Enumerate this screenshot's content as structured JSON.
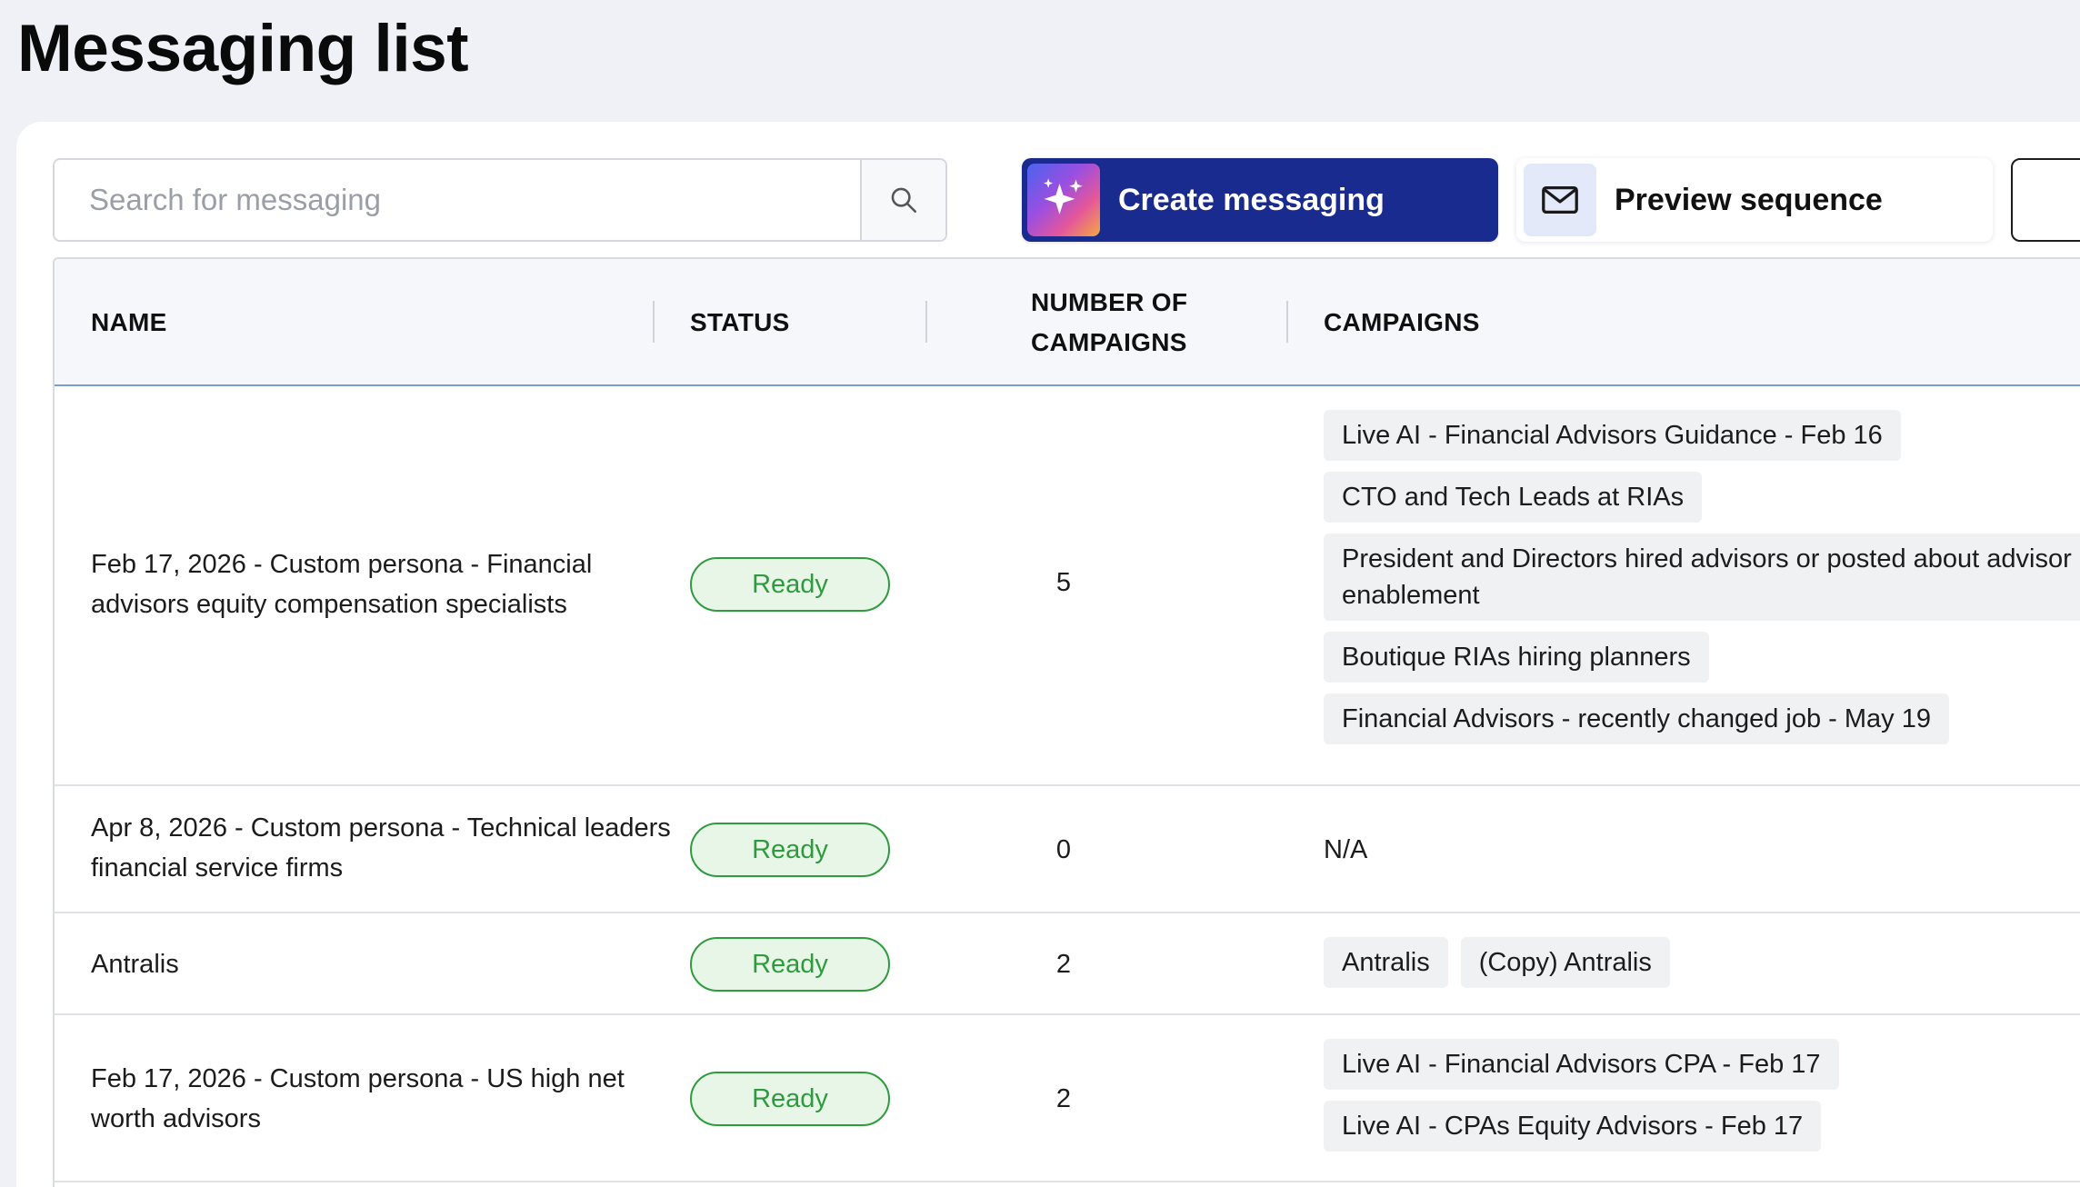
{
  "page": {
    "title": "Messaging list"
  },
  "toolbar": {
    "search_placeholder": "Search for messaging",
    "create_label": "Create messaging",
    "preview_label": "Preview sequence"
  },
  "table": {
    "headers": {
      "name": "NAME",
      "status": "STATUS",
      "count_line1": "NUMBER OF",
      "count_line2": "CAMPAIGNS",
      "campaigns": "CAMPAIGNS"
    },
    "rows": [
      {
        "name": "Feb 17, 2026 - Custom persona - Financial advisors equity compensation specialists",
        "status": "Ready",
        "count": "5",
        "campaigns": [
          "Live AI - Financial Advisors Guidance - Feb 16",
          "CTO and Tech Leads at RIAs",
          "President and Directors hired advisors or posted about advisor enablement",
          "Boutique RIAs hiring planners",
          "Financial Advisors - recently changed job - May 19"
        ]
      },
      {
        "name": "Apr 8, 2026 - Custom persona - Technical leaders financial service firms",
        "status": "Ready",
        "count": "0",
        "campaigns_empty": "N/A"
      },
      {
        "name": "Antralis",
        "status": "Ready",
        "count": "2",
        "campaigns": [
          "Antralis",
          "(Copy) Antralis"
        ]
      },
      {
        "name": "Feb 17, 2026 - Custom persona - US high net worth advisors",
        "status": "Ready",
        "count": "2",
        "campaigns": [
          "Live AI - Financial Advisors CPA - Feb 17",
          "Live AI - CPAs Equity Advisors - Feb 17"
        ]
      }
    ]
  },
  "colors": {
    "primary": "#1a2b8f",
    "status_ready": "#2e9b3e",
    "background": "#eff1f6"
  },
  "icons": {
    "search": "search-icon",
    "create": "sparkle-icon",
    "preview": "envelope-icon"
  }
}
